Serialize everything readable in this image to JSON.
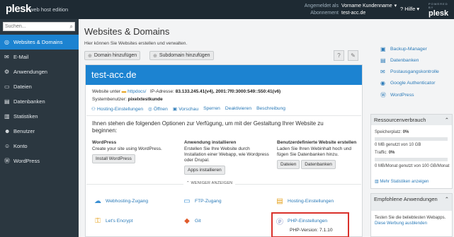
{
  "header": {
    "logo": "plesk",
    "edition": "web host edition",
    "logged_in_label": "Angemeldet als",
    "logged_in_value": "Vorname Kundenname",
    "subscription_label": "Abonnement",
    "subscription_value": "test-acc.de",
    "help_label": "Hilfe",
    "brand_small": "POWERED BY",
    "brand": "plesk"
  },
  "sidebar": {
    "search_placeholder": "Suchen...",
    "items": [
      {
        "label": "Websites & Domains",
        "icon": "globe-icon"
      },
      {
        "label": "E-Mail",
        "icon": "mail-icon"
      },
      {
        "label": "Anwendungen",
        "icon": "apps-icon"
      },
      {
        "label": "Dateien",
        "icon": "folder-icon"
      },
      {
        "label": "Datenbanken",
        "icon": "database-icon"
      },
      {
        "label": "Statistiken",
        "icon": "stats-icon"
      },
      {
        "label": "Benutzer",
        "icon": "user-icon"
      },
      {
        "label": "Konto",
        "icon": "account-icon"
      },
      {
        "label": "WordPress",
        "icon": "wordpress-icon"
      }
    ]
  },
  "main": {
    "title": "Websites & Domains",
    "subtitle": "Hier können Sie Websites erstellen und verwalten.",
    "add_domain": "Domain hinzufügen",
    "add_subdomain": "Subdomain hinzufügen",
    "domain": {
      "name": "test-acc.de",
      "website_label": "Website unter",
      "docroot": "httpdocs/",
      "ip_label": "IP-Adresse:",
      "ip_value": "83.133.245.41(v4), 2001:7f0:3000:549::550:41(v6)",
      "sysuser_label": "Systembenutzer:",
      "sysuser_value": "pixelxtestkunde",
      "tools": [
        "Hosting-Einstellungen",
        "Öffnen",
        "Vorschau",
        "Sperren",
        "Deaktivieren",
        "Beschreibung"
      ],
      "intro": "Ihnen stehen die folgenden Optionen zur Verfügung, um mit der Gestaltung Ihrer Website zu beginnen:",
      "options": [
        {
          "title": "WordPress",
          "text": "Create your site using WordPress.",
          "buttons": [
            "Install WordPress"
          ]
        },
        {
          "title": "Anwendung installieren",
          "text": "Erstellen Sie Ihre Website durch Installation einer Webapp, wie Wordpress oder Drupal.",
          "buttons": [
            "Apps installieren"
          ]
        },
        {
          "title": "Benutzerdefinierte Website erstellen",
          "text": "Laden Sie Ihren Webinhalt hoch und fügen Sie Datenbanken hinzu.",
          "buttons": [
            "Dateien",
            "Datenbanken"
          ]
        }
      ],
      "less_label": "⌃ WENIGER ANZEIGEN",
      "links": [
        "Webhosting-Zugang",
        "FTP-Zugang",
        "Hosting-Einstellungen",
        "Let's Encrypt",
        "Git",
        "PHP-Einstellungen"
      ],
      "php_version_label": "PHP-Version:",
      "php_version_value": "7.1.10"
    }
  },
  "right": {
    "links": [
      "Backup-Manager",
      "Datenbanken",
      "Postausgangskontrolle",
      "Google Authenticator",
      "WordPress"
    ],
    "resources": {
      "title": "Ressourcenverbrauch",
      "storage_label": "Speicherplatz:",
      "storage_value": "0%",
      "storage_fill": 0,
      "storage_detail": "0 MB genutzt von 10 GB",
      "traffic_label": "Traffic:",
      "traffic_value": "0%",
      "traffic_fill": 0,
      "traffic_detail": "0 MB/Monat genutzt von 100 GB/Monat",
      "more_stats": "Mehr Statistiken anzeigen"
    },
    "recommended": {
      "title": "Empfohlene Anwendungen",
      "text": "Testen Sie die beliebtesten Webapps.",
      "hide_link": "Diese Werbung ausblenden"
    }
  }
}
